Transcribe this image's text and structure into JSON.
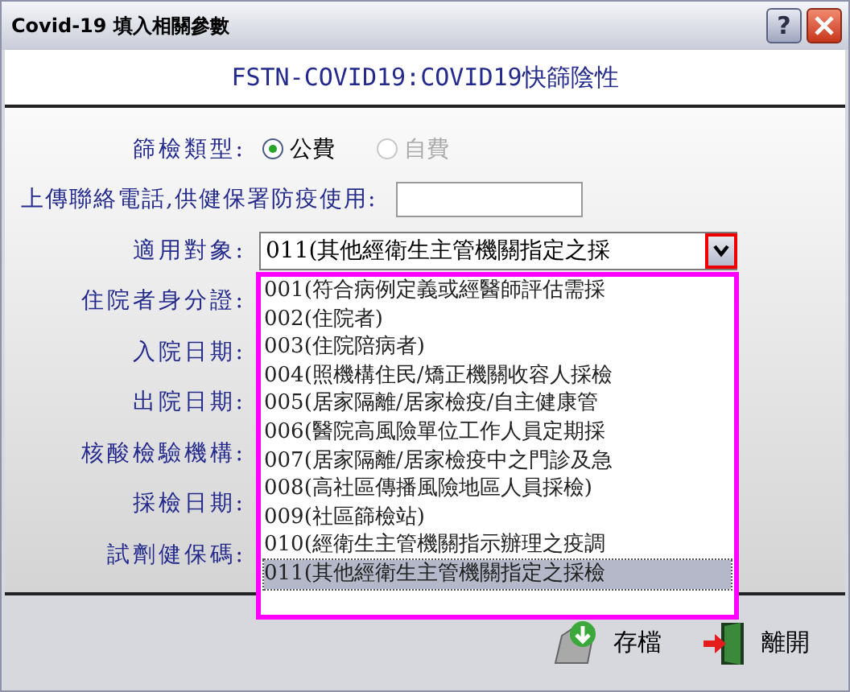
{
  "window": {
    "title": "Covid-19 填入相關參數"
  },
  "title_buttons": [
    {
      "kind": "help",
      "label": "?"
    },
    {
      "kind": "close"
    }
  ],
  "header": "FSTN-COVID19:COVID19快篩陰性",
  "fields": [
    {
      "kind": "radio",
      "label": "篩檢類型:",
      "options": [
        {
          "label": "公費",
          "selected": true,
          "disabled": false
        },
        {
          "label": "自費",
          "selected": false,
          "disabled": true
        }
      ]
    },
    {
      "kind": "text",
      "label": "上傳聯絡電話,供健保署防疫使用:"
    },
    {
      "kind": "select",
      "label": "適用對象:",
      "value": "011(其他經衛生主管機關指定之採"
    },
    {
      "kind": "label",
      "label": "住院者身分證:"
    },
    {
      "kind": "label",
      "label": "入院日期:"
    },
    {
      "kind": "label",
      "label": "出院日期:"
    },
    {
      "kind": "label",
      "label": "核酸檢驗機構:"
    },
    {
      "kind": "label",
      "label": "採檢日期:"
    },
    {
      "kind": "label",
      "label": "試劑健保碼:"
    }
  ],
  "dropdown": [
    {
      "label": "001(符合病例定義或經醫師評估需採",
      "selected": false
    },
    {
      "label": "002(住院者)",
      "selected": false
    },
    {
      "label": "003(住院陪病者)",
      "selected": false
    },
    {
      "label": "004(照機構住民/矯正機關收容人採檢",
      "selected": false
    },
    {
      "label": "005(居家隔離/居家檢疫/自主健康管",
      "selected": false
    },
    {
      "label": "006(醫院高風險單位工作人員定期採",
      "selected": false
    },
    {
      "label": "007(居家隔離/居家檢疫中之門診及急",
      "selected": false
    },
    {
      "label": "008(高社區傳播風險地區人員採檢)",
      "selected": false
    },
    {
      "label": "009(社區篩檢站)",
      "selected": false
    },
    {
      "label": "010(經衛生主管機關指示辦理之疫調",
      "selected": false
    },
    {
      "label": "011(其他經衛生主管機關指定之採檢",
      "selected": true
    }
  ],
  "buttons": [
    {
      "kind": "save",
      "label": "存檔"
    },
    {
      "kind": "exit",
      "label": "離開"
    }
  ]
}
